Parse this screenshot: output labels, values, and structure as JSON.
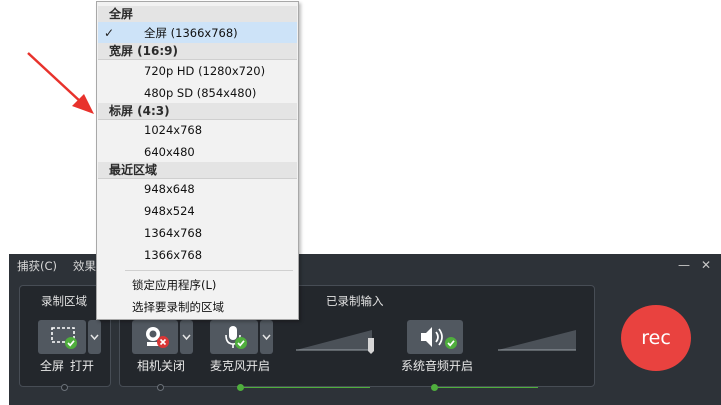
{
  "window": {
    "menu": [
      "捕获(C)",
      "效果"
    ],
    "minimize_glyph": "—",
    "close_glyph": "✕"
  },
  "record_area": {
    "label": "录制区域",
    "fullscreen_label": "全屏",
    "open_label": "打开"
  },
  "recorded_inputs": {
    "label": "已录制输入",
    "camera_label": "相机关闭",
    "mic_label": "麦克风开启",
    "system_audio_label": "系统音频开启"
  },
  "rec_button": "rec",
  "dropdown": {
    "sections": [
      {
        "header": "全屏",
        "items": [
          {
            "label": "全屏 (1366x768)",
            "checked": true
          }
        ]
      },
      {
        "header": "宽屏 (16:9)",
        "items": [
          {
            "label": "720p HD (1280x720)"
          },
          {
            "label": "480p SD (854x480)"
          }
        ]
      },
      {
        "header": "标屏 (4:3)",
        "items": [
          {
            "label": "1024x768"
          },
          {
            "label": "640x480"
          }
        ]
      },
      {
        "header": "最近区域",
        "items": [
          {
            "label": "948x648"
          },
          {
            "label": "948x524"
          },
          {
            "label": "1364x768"
          },
          {
            "label": "1366x768"
          }
        ]
      }
    ],
    "actions": [
      "锁定应用程序(L)",
      "选择要录制的区域"
    ],
    "check_glyph": "✓"
  },
  "colors": {
    "accent_green": "#4fae3d",
    "rec_red": "#e9423f",
    "annotation_arrow": "#e8322c",
    "selected_item": "#cde3f8"
  },
  "icons": [
    "checkmark-icon",
    "screen-region-icon",
    "webcam-icon",
    "microphone-icon",
    "speaker-icon",
    "chevron-down-icon",
    "annotation-arrow-icon"
  ]
}
